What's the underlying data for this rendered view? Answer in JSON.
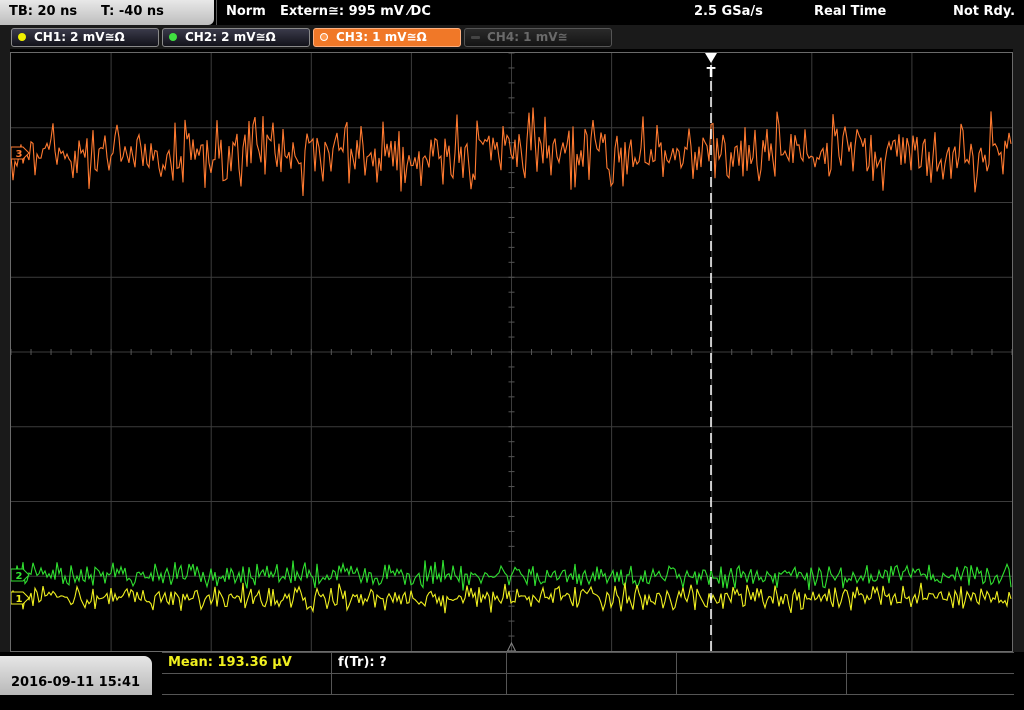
{
  "topbar": {
    "timebase": "TB: 20 ns",
    "trigger_time": "T: -40 ns",
    "trigger_mode": "Norm",
    "trigger_source": "Extern≅: 995 mV ⁄DC",
    "sample_rate": "2.5 GSa/s",
    "acq_mode": "Real Time",
    "status": "Not Rdy."
  },
  "channels": [
    {
      "label": "CH1: 2 mV≅Ω",
      "color": "#f0f000",
      "state": "on"
    },
    {
      "label": "CH2: 2 mV≅Ω",
      "color": "#40e040",
      "state": "on"
    },
    {
      "label": "CH3: 1 mV≅Ω",
      "color": "#ff8030",
      "state": "active"
    },
    {
      "label": "CH4: 1 mV≅",
      "color": "#555555",
      "state": "off"
    }
  ],
  "markers": {
    "trigger_marker": "T",
    "ch3_marker": "3",
    "ch2_marker": "2",
    "ch1_marker": "1"
  },
  "waveform_colors": {
    "ch1": "#f0f020",
    "ch2": "#30e030",
    "ch3": "#ff7a30",
    "grid": "#3c3c3c"
  },
  "footer": {
    "datetime": "2016-09-11 15:41",
    "mean_label": "Mean: 193.36 µV",
    "freq_label": "f(Tr): ?"
  }
}
